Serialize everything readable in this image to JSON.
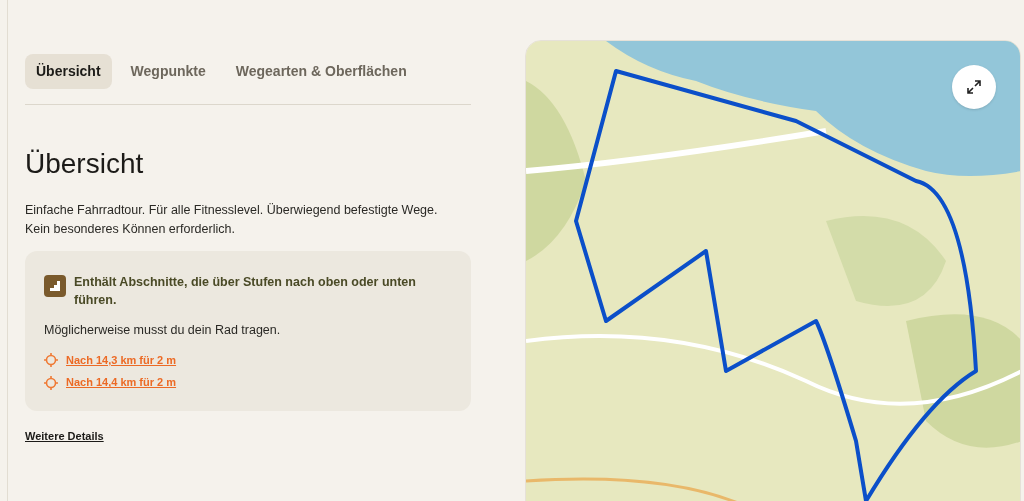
{
  "tabs": [
    {
      "label": "Übersicht",
      "selected": true
    },
    {
      "label": "Wegpunkte",
      "selected": false
    },
    {
      "label": "Wegearten & Oberflächen",
      "selected": false
    }
  ],
  "overview": {
    "heading": "Übersicht",
    "description": "Einfache Fahrradtour. Für alle Fitnesslevel. Überwiegend befestigte Wege. Kein besonderes Können erforderlich.",
    "notice": {
      "title": "Enthält Abschnitte, die über Stufen nach oben oder unten führen.",
      "note": "Möglicherweise musst du dein Rad tragen.",
      "locations": [
        "Nach 14,3 km für 2 m",
        "Nach 14,4 km für 2 m"
      ]
    },
    "more_link": "Weitere Details"
  }
}
